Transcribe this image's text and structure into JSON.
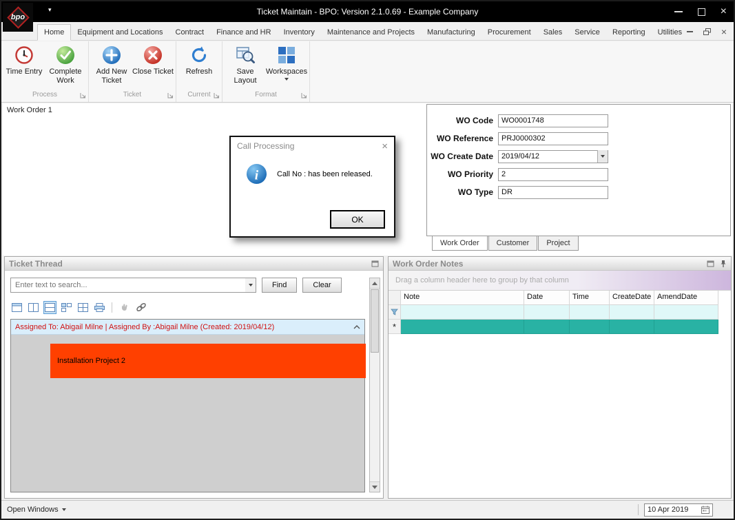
{
  "window": {
    "title": "Ticket Maintain - BPO: Version 2.1.0.69 - Example Company",
    "logo_text": "bpo"
  },
  "ribbon": {
    "tabs": [
      {
        "label": "Home"
      },
      {
        "label": "Equipment and Locations"
      },
      {
        "label": "Contract"
      },
      {
        "label": "Finance and HR"
      },
      {
        "label": "Inventory"
      },
      {
        "label": "Maintenance and Projects"
      },
      {
        "label": "Manufacturing"
      },
      {
        "label": "Procurement"
      },
      {
        "label": "Sales"
      },
      {
        "label": "Service"
      },
      {
        "label": "Reporting"
      },
      {
        "label": "Utilities"
      }
    ],
    "buttons": {
      "time_entry": "Time Entry",
      "complete_work": "Complete Work",
      "add_new_ticket": "Add New Ticket",
      "close_ticket": "Close Ticket",
      "refresh": "Refresh",
      "save_layout": "Save Layout",
      "workspaces": "Workspaces"
    },
    "groups": {
      "process": "Process",
      "ticket": "Ticket",
      "current": "Current",
      "format": "Format"
    }
  },
  "canvas": {
    "work_order_label": "Work Order 1"
  },
  "dialog": {
    "title": "Call Processing",
    "message": "Call No :  has been released.",
    "ok": "OK"
  },
  "form": {
    "fields": [
      {
        "label": "WO Code",
        "value": "WO0001748"
      },
      {
        "label": "WO Reference",
        "value": "PRJ0000302"
      },
      {
        "label": "WO Create Date",
        "value": "2019/04/12"
      },
      {
        "label": "WO Priority",
        "value": "2"
      },
      {
        "label": "WO Type",
        "value": "DR"
      }
    ],
    "tabs": [
      {
        "label": "Work Order"
      },
      {
        "label": "Customer"
      },
      {
        "label": "Project"
      }
    ]
  },
  "ticket_thread": {
    "title": "Ticket Thread",
    "search_placeholder": "Enter text to search...",
    "find": "Find",
    "clear": "Clear",
    "thread_header": "Assigned To: Abigail Milne | Assigned By :Abigail Milne (Created: 2019/04/12)",
    "thread_item": "Installation Project 2"
  },
  "notes": {
    "title": "Work Order Notes",
    "group_hint": "Drag a column header here to group by that column",
    "columns": [
      "Note",
      "Date",
      "Time",
      "CreateDate",
      "AmendDate"
    ]
  },
  "statusbar": {
    "open_windows": "Open Windows",
    "date": "10 Apr 2019"
  }
}
